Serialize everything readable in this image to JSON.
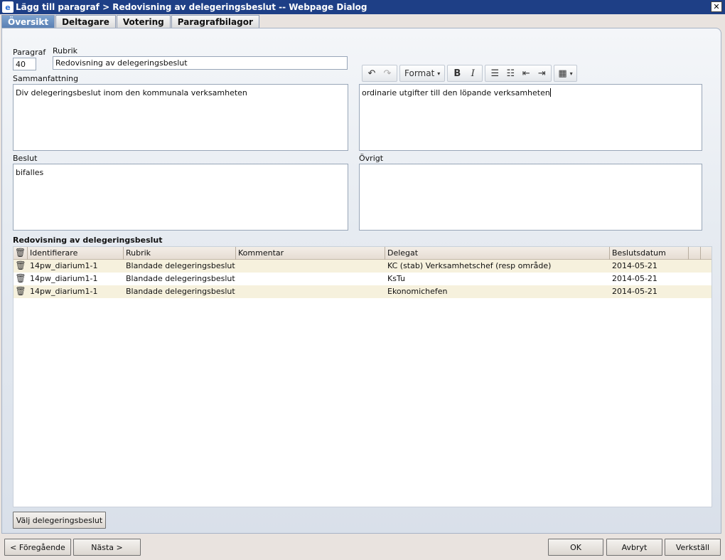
{
  "window": {
    "title": "Lägg till paragraf > Redovisning av delegeringsbeslut -- Webpage Dialog",
    "close_glyph": "✕"
  },
  "tabs": [
    {
      "label": "Översikt",
      "active": true
    },
    {
      "label": "Deltagare",
      "active": false
    },
    {
      "label": "Votering",
      "active": false
    },
    {
      "label": "Paragrafbilagor",
      "active": false
    }
  ],
  "form": {
    "paragraf_label": "Paragraf",
    "paragraf_value": "40",
    "rubrik_label": "Rubrik",
    "rubrik_value": "Redovisning av delegeringsbeslut",
    "sammanfattning_label": "Sammanfattning",
    "sammanfattning_value": "Div delegeringsbeslut inom den kommunala verksamheten",
    "editor_value": "ordinarie utgifter till den löpande verksamheten",
    "beslut_label": "Beslut",
    "beslut_value": "bifalles",
    "ovrigt_label": "Övrigt",
    "ovrigt_value": ""
  },
  "editor_toolbar": {
    "undo_icon": "↶",
    "redo_icon": "↷",
    "format_label": "Format",
    "dropdown_glyph": "▾",
    "bold_label": "B",
    "italic_label": "I",
    "bullet_list_icon": "☰",
    "numbered_list_icon": "☷",
    "outdent_icon": "⇤",
    "indent_icon": "⇥",
    "table_icon": "▦"
  },
  "grid": {
    "title": "Redovisning av delegeringsbeslut",
    "delete_icon": "🗑",
    "columns": [
      "Identifierare",
      "Rubrik",
      "Kommentar",
      "Delegat",
      "Beslutsdatum"
    ],
    "rows": [
      {
        "identifierare": "14pw_diarium1-1",
        "rubrik": "Blandade delegeringsbeslut",
        "kommentar": "",
        "delegat": "KC (stab) Verksamhetschef (resp område)",
        "beslutsdatum": "2014-05-21"
      },
      {
        "identifierare": "14pw_diarium1-1",
        "rubrik": "Blandade delegeringsbeslut",
        "kommentar": "",
        "delegat": "KsTu",
        "beslutsdatum": "2014-05-21"
      },
      {
        "identifierare": "14pw_diarium1-1",
        "rubrik": "Blandade delegeringsbeslut",
        "kommentar": "",
        "delegat": "Ekonomichefen",
        "beslutsdatum": "2014-05-21"
      }
    ]
  },
  "buttons": {
    "valj": "Välj delegeringsbeslut",
    "foregaende": "< Föregående",
    "nasta": "Nästa >",
    "ok": "OK",
    "avbryt": "Avbryt",
    "verkstall": "Verkställ"
  }
}
